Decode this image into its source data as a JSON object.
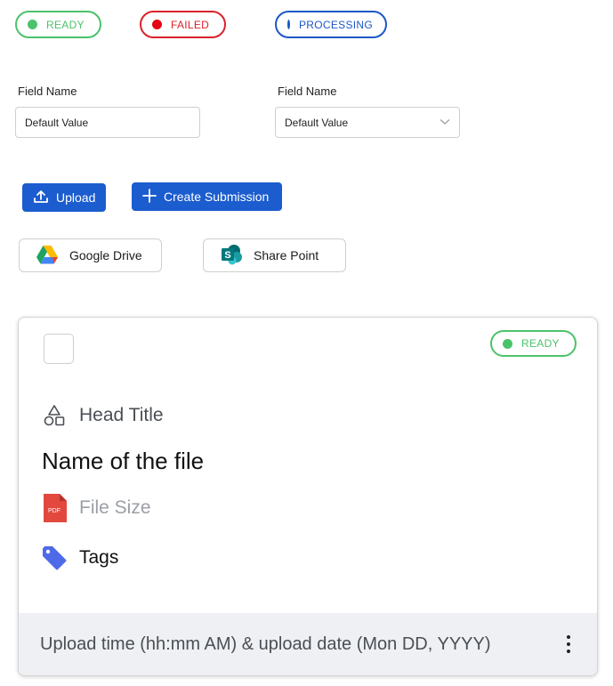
{
  "status_badges": [
    {
      "label": "READY",
      "color": "#4cc26b"
    },
    {
      "label": "FAILED",
      "color": "#e30613"
    },
    {
      "label": "PROCESSING",
      "color": "#1d57c7"
    }
  ],
  "fields": {
    "text_field": {
      "label": "Field Name",
      "value": "Default Value"
    },
    "select_field": {
      "label": "Field Name",
      "value": "Default Value",
      "icon": "chevron-down-icon"
    }
  },
  "buttons": {
    "upload": {
      "label": "Upload",
      "icon": "upload-icon"
    },
    "create_submission": {
      "label": "Create Submission",
      "icon": "plus-icon"
    },
    "google_drive": {
      "label": "Google Drive",
      "icon": "google-drive-icon"
    },
    "share_point": {
      "label": "Share Point",
      "icon": "sharepoint-icon"
    }
  },
  "file_card": {
    "status": "READY",
    "head_title": "Head Title",
    "file_name": "Name of the file",
    "file_size": "File Size",
    "file_type_badge": "PDF",
    "tags": "Tags",
    "footer": "Upload time (hh:mm AM) & upload date (Mon DD, YYYY)"
  },
  "colors": {
    "primary": "#1b5ccf",
    "ready": "#4cc26b",
    "failed": "#e30613",
    "processing": "#1d57c7",
    "tag_icon": "#4f6ae8",
    "pdf_icon": "#e2483d"
  }
}
